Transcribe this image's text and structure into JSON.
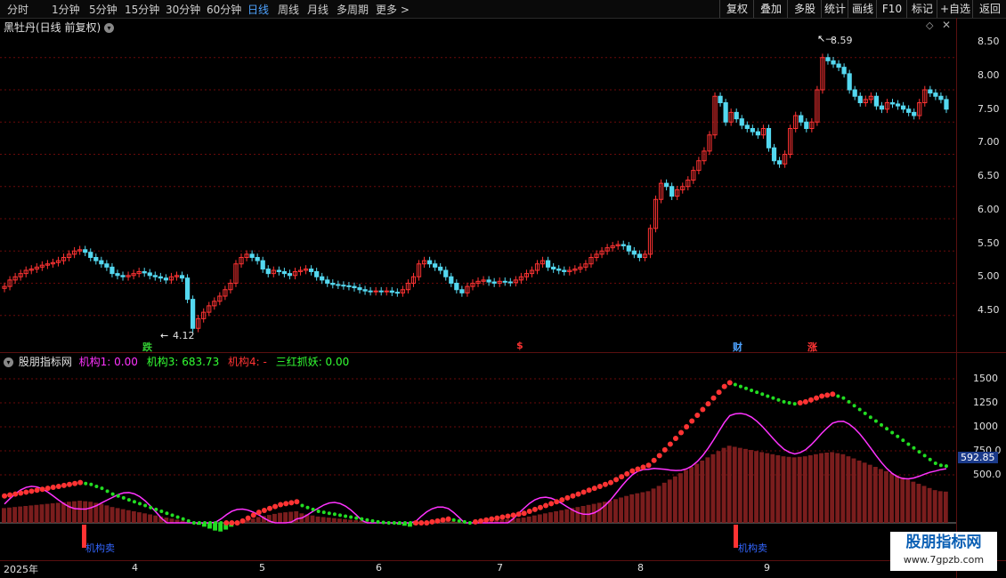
{
  "toolbar": {
    "periods": [
      "分时",
      "1分钟",
      "5分钟",
      "15分钟",
      "30分钟",
      "60分钟",
      "日线",
      "周线",
      "月线",
      "多周期",
      "更多 >"
    ],
    "active_period": "日线",
    "actions": [
      "复权",
      "叠加",
      "多股",
      "统计",
      "画线",
      "F10",
      "标记",
      "+自选",
      "返回"
    ]
  },
  "main_panel": {
    "stock_title": "黑牡丹(日线 前复权)",
    "y_ticks": [
      "8.50",
      "8.00",
      "7.50",
      "7.00",
      "6.50",
      "6.00",
      "5.50",
      "5.00",
      "4.50"
    ],
    "high_label": "8.59",
    "low_label": "4.12",
    "event_tags": [
      {
        "text": "跌",
        "color": "#33cc33"
      },
      {
        "text": "$",
        "color": "#ff3333"
      },
      {
        "text": "财",
        "color": "#4ea3ff"
      },
      {
        "text": "涨",
        "color": "#ff3333"
      }
    ]
  },
  "indicator_panel": {
    "name": "股朋指标网",
    "legend": [
      {
        "text": "机构1: 0.00",
        "color": "#ff33ff"
      },
      {
        "text": "机构3: 683.73",
        "color": "#33ff33"
      },
      {
        "text": "机构4: -",
        "color": "#ff3333"
      },
      {
        "text": "三红抓妖: 0.00",
        "color": "#33ff33"
      }
    ],
    "y_ticks": [
      "1500",
      "1250",
      "1000",
      "750.0",
      "500.0"
    ],
    "current_value": "592.85",
    "signal_label": "机构卖"
  },
  "x_axis": {
    "labels": [
      "2025年",
      "4",
      "5",
      "6",
      "7",
      "8",
      "9"
    ]
  },
  "watermark": {
    "line1": "股朋指标网",
    "line2": "www.7gpzb.com"
  },
  "colors": {
    "up": "#ff3333",
    "down": "#54d8f0",
    "grid": "#6a0a0a",
    "magenta": "#ff33ff",
    "green": "#22dd22"
  },
  "chart_data": {
    "type": "candlestick",
    "price_range": [
      4.0,
      8.8
    ],
    "close": [
      4.95,
      5.05,
      5.1,
      5.15,
      5.2,
      5.22,
      5.25,
      5.28,
      5.3,
      5.32,
      5.35,
      5.4,
      5.45,
      5.5,
      5.52,
      5.48,
      5.4,
      5.35,
      5.3,
      5.25,
      5.15,
      5.12,
      5.1,
      5.12,
      5.15,
      5.18,
      5.16,
      5.12,
      5.1,
      5.08,
      5.05,
      5.1,
      5.12,
      5.08,
      4.75,
      4.3,
      4.45,
      4.55,
      4.65,
      4.72,
      4.8,
      4.9,
      5.0,
      5.3,
      5.4,
      5.45,
      5.4,
      5.35,
      5.22,
      5.15,
      5.2,
      5.18,
      5.15,
      5.12,
      5.18,
      5.2,
      5.22,
      5.18,
      5.1,
      5.05,
      5.0,
      4.98,
      4.97,
      4.96,
      4.95,
      4.93,
      4.9,
      4.88,
      4.87,
      4.88,
      4.87,
      4.88,
      4.86,
      4.85,
      4.9,
      5.0,
      5.1,
      5.3,
      5.35,
      5.3,
      5.25,
      5.2,
      5.1,
      5.0,
      4.9,
      4.85,
      4.95,
      5.0,
      5.03,
      5.05,
      5.02,
      5.0,
      5.03,
      5.02,
      5.01,
      5.05,
      5.1,
      5.15,
      5.2,
      5.3,
      5.35,
      5.25,
      5.22,
      5.2,
      5.18,
      5.2,
      5.22,
      5.25,
      5.3,
      5.4,
      5.45,
      5.5,
      5.55,
      5.58,
      5.6,
      5.58,
      5.5,
      5.45,
      5.4,
      5.45,
      5.85,
      6.3,
      6.55,
      6.5,
      6.35,
      6.45,
      6.5,
      6.6,
      6.75,
      6.9,
      7.05,
      7.3,
      7.9,
      7.8,
      7.5,
      7.65,
      7.55,
      7.45,
      7.4,
      7.35,
      7.3,
      7.4,
      7.1,
      6.9,
      6.85,
      7.0,
      7.4,
      7.6,
      7.5,
      7.4,
      7.5,
      8.0,
      8.5,
      8.45,
      8.4,
      8.35,
      8.25,
      8.0,
      7.9,
      7.8,
      7.85,
      7.9,
      7.75,
      7.7,
      7.8,
      7.78,
      7.75,
      7.7,
      7.65,
      7.6,
      7.8,
      8.0,
      7.95,
      7.9,
      7.85,
      7.7
    ],
    "indicator_values": [
      280,
      290,
      300,
      310,
      320,
      330,
      340,
      350,
      360,
      370,
      380,
      390,
      400,
      410,
      420,
      410,
      400,
      380,
      360,
      330,
      300,
      280,
      260,
      240,
      220,
      200,
      180,
      160,
      140,
      120,
      100,
      80,
      60,
      40,
      20,
      0,
      -20,
      -40,
      -60,
      -80,
      -90,
      -70,
      -40,
      -10,
      20,
      50,
      80,
      110,
      130,
      150,
      170,
      190,
      200,
      210,
      220,
      180,
      160,
      140,
      120,
      110,
      100,
      90,
      80,
      70,
      60,
      50,
      40,
      30,
      20,
      10,
      5,
      0,
      -10,
      -20,
      -30,
      -40,
      -20,
      -10,
      0,
      10,
      20,
      30,
      40,
      30,
      20,
      10,
      0,
      10,
      20,
      30,
      40,
      50,
      60,
      70,
      80,
      90,
      100,
      120,
      140,
      160,
      180,
      200,
      220,
      240,
      260,
      280,
      300,
      320,
      340,
      360,
      380,
      400,
      420,
      450,
      480,
      510,
      540,
      560,
      580,
      600,
      650,
      700,
      760,
      820,
      880,
      940,
      1000,
      1060,
      1120,
      1180,
      1240,
      1300,
      1360,
      1420,
      1460,
      1440,
      1420,
      1400,
      1380,
      1360,
      1340,
      1320,
      1300,
      1280,
      1260,
      1250,
      1240,
      1250,
      1260,
      1280,
      1300,
      1320,
      1330,
      1340,
      1320,
      1300,
      1260,
      1220,
      1180,
      1140,
      1100,
      1060,
      1020,
      980,
      940,
      900,
      860,
      820,
      780,
      740,
      700,
      660,
      620,
      600,
      592
    ]
  }
}
